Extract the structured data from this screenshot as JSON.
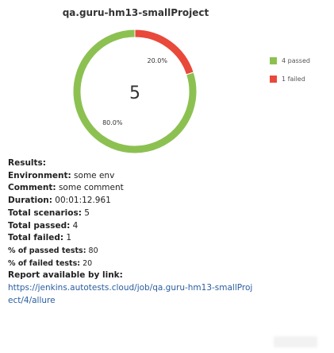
{
  "chart_data": {
    "type": "pie",
    "title": "qa.guru-hm13-smallProject",
    "center_value": "5",
    "slices": [
      {
        "name": "passed",
        "value": 4,
        "label": "80.0%",
        "color": "#8cc152"
      },
      {
        "name": "failed",
        "value": 1,
        "label": "20.0%",
        "color": "#e8493b"
      }
    ],
    "legend": [
      {
        "text": "4 passed",
        "color": "#8cc152"
      },
      {
        "text": "1 failed",
        "color": "#e8493b"
      }
    ],
    "legend_position": "right"
  },
  "results": {
    "heading": "Results:",
    "environment": {
      "label": "Environment:",
      "value": " some env"
    },
    "comment": {
      "label": "Comment:",
      "value": " some comment"
    },
    "duration": {
      "label": "Duration:",
      "value": " 00:01:12.961"
    },
    "total_scenarios": {
      "label": "Total scenarios:",
      "value": " 5"
    },
    "total_passed": {
      "label": "Total passed:",
      "value": " 4"
    },
    "total_failed": {
      "label": "Total failed:",
      "value": " 1"
    },
    "pct_passed": {
      "label": "% of passed tests:",
      "value": " 80"
    },
    "pct_failed": {
      "label": "% of failed tests:",
      "value": " 20"
    },
    "report_label": "Report available by link:",
    "report_link": "https://jenkins.autotests.cloud/job/qa.guru-hm13-smallProject/4/allure"
  }
}
